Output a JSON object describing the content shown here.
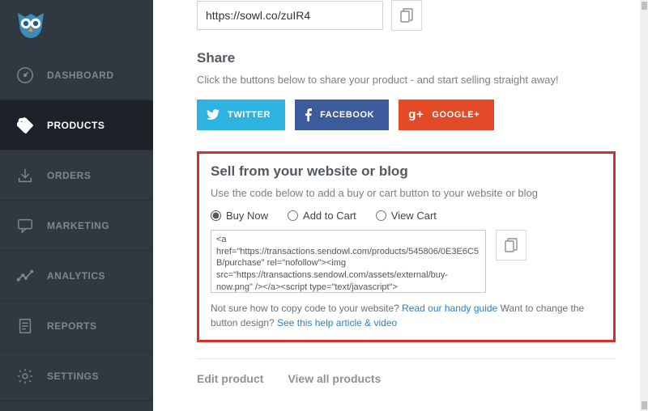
{
  "sidebar": {
    "items": [
      {
        "label": "DASHBOARD"
      },
      {
        "label": "PRODUCTS"
      },
      {
        "label": "ORDERS"
      },
      {
        "label": "MARKETING"
      },
      {
        "label": "ANALYTICS"
      },
      {
        "label": "REPORTS"
      },
      {
        "label": "SETTINGS"
      }
    ]
  },
  "url_box": {
    "value": "https://sowl.co/zuIR4"
  },
  "share": {
    "heading": "Share",
    "sub": "Click the buttons below to share your product - and start selling straight away!",
    "twitter": "TWITTER",
    "facebook": "FACEBOOK",
    "google": "GOOGLE+"
  },
  "sell": {
    "heading": "Sell from your website or blog",
    "sub": "Use the code below to add a buy or cart button to your website or blog",
    "radios": {
      "buy_now": "Buy Now",
      "add_to_cart": "Add to Cart",
      "view_cart": "View Cart"
    },
    "code": "<a href=\"https://transactions.sendowl.com/products/545806/0E3E6C5B/purchase\" rel=\"nofollow\"><img src=\"https://transactions.sendowl.com/assets/external/buy-now.png\" /></a><script type=\"text/javascript\">",
    "helper": {
      "pre_guide": "Not sure how to copy code to your website? ",
      "guide": "Read our handy guide",
      "mid": "  Want to change the button design? ",
      "design": "See this help article & video"
    }
  },
  "bottom": {
    "edit": "Edit product",
    "view_all": "View all products"
  }
}
